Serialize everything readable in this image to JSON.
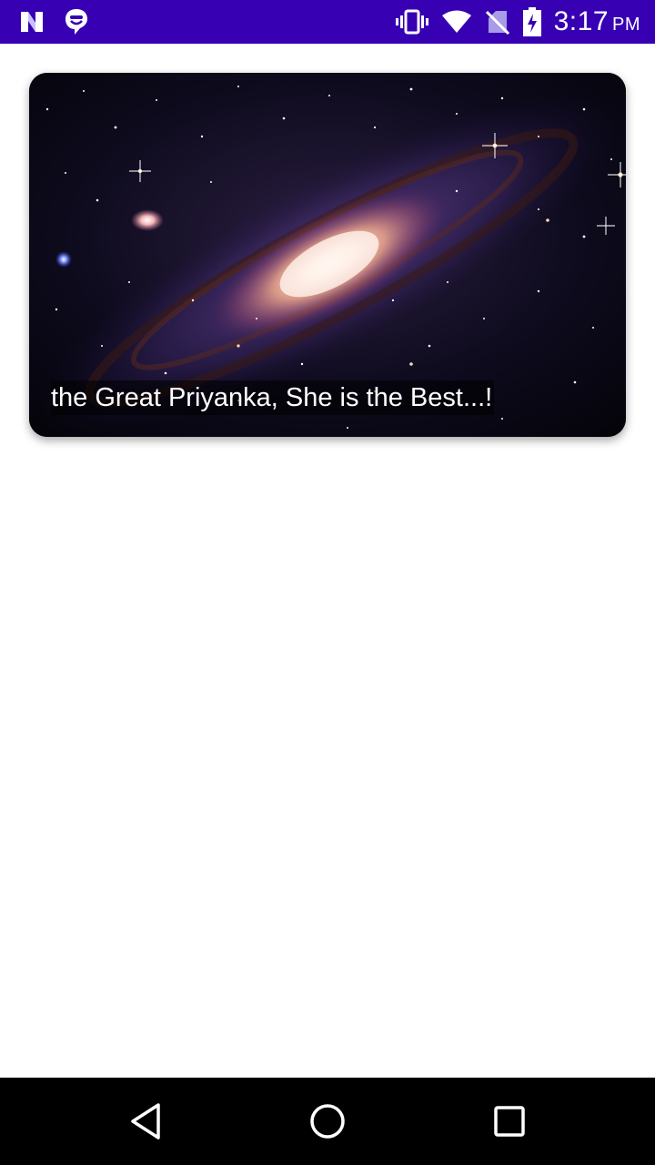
{
  "status_bar": {
    "background": "#3700b3",
    "left_icons": [
      "n-logo-icon",
      "messenger-icon"
    ],
    "right_icons": [
      "vibrate-icon",
      "wifi-icon",
      "no-sim-icon",
      "battery-charging-icon"
    ],
    "time": "3:17",
    "ampm": "PM"
  },
  "card": {
    "image": "galaxy-image",
    "caption": "the Great Priyanka, She is the Best...!"
  },
  "nav_bar": {
    "buttons": [
      "back-icon",
      "home-icon",
      "recents-icon"
    ]
  }
}
